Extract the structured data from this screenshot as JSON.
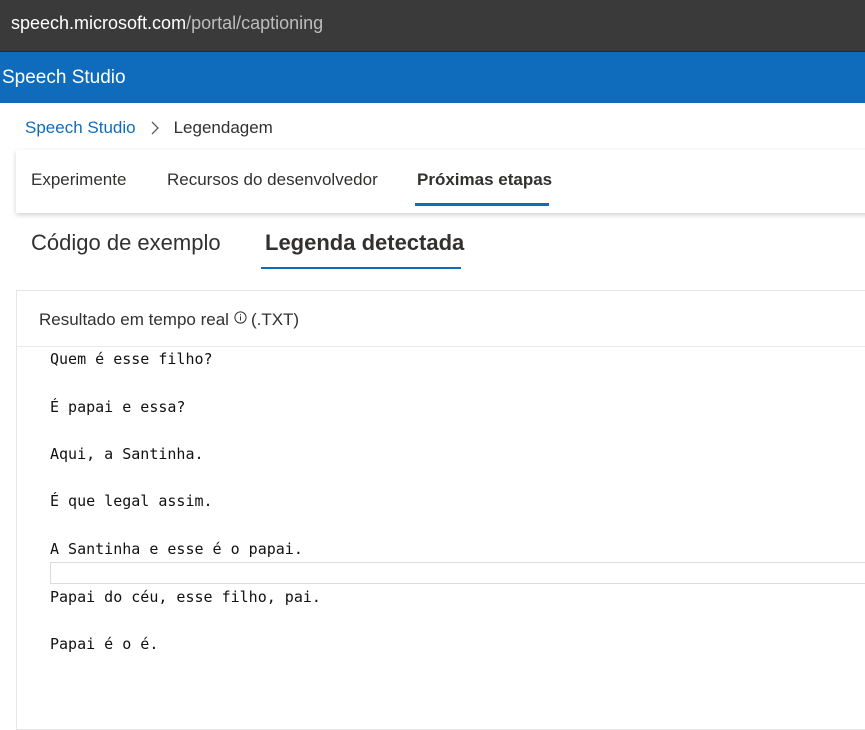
{
  "browser": {
    "url_host": "speech.microsoft.com",
    "url_path": "/portal/captioning"
  },
  "app": {
    "title": "Speech Studio"
  },
  "breadcrumb": {
    "home": "Speech Studio",
    "current": "Legendagem"
  },
  "tabs": [
    {
      "label": "Experimente",
      "active": false
    },
    {
      "label": "Recursos do desenvolvedor",
      "active": false
    },
    {
      "label": "Próximas etapas",
      "active": true
    }
  ],
  "subtabs": [
    {
      "label": "Código de exemplo",
      "active": false
    },
    {
      "label": "Legenda detectada",
      "active": true
    }
  ],
  "panel": {
    "title": "Resultado em tempo real",
    "format": "(.TXT)"
  },
  "captions": [
    "Quem é esse filho?",
    "É papai e essa?",
    "Aqui, a Santinha.",
    "É que legal assim.",
    "A Santinha e esse é o papai.",
    "Papai do céu, esse filho, pai.",
    "Papai é o é."
  ],
  "colors": {
    "accent": "#0f6cbd",
    "browser_bar": "#3a3a3a"
  }
}
